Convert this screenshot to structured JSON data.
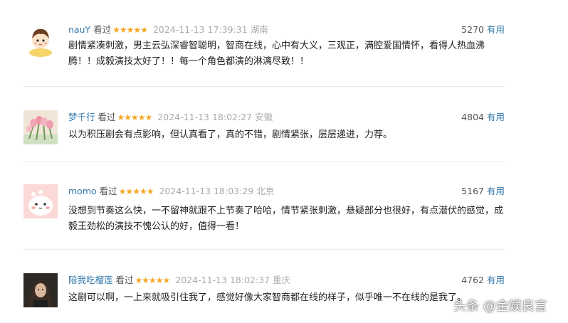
{
  "reviews": [
    {
      "user": "nauY",
      "watched": "看过",
      "stars": "★★★★★",
      "time": "2024-11-13 17:39:31",
      "location": "湖南",
      "votes": "5270",
      "vote_label": "有用",
      "text": "剧情紧凑刺激，男主云弘深睿智聪明，智商在线，心中有大义，三观正，满腔爱国情怀，看得人热血沸腾！！成毅演技太好了！！每一个角色都演的淋漓尽致！！"
    },
    {
      "user": "梦千行",
      "watched": "看过",
      "stars": "★★★★★",
      "time": "2024-11-13 18:02:27",
      "location": "安徽",
      "votes": "4804",
      "vote_label": "有用",
      "text": "以为积压剧会有点影响，但认真看了，真的不错，剧情紧张，层层递进，力荐。"
    },
    {
      "user": "momo",
      "watched": "看过",
      "stars": "★★★★★",
      "time": "2024-11-13 18:03:29",
      "location": "北京",
      "votes": "5167",
      "vote_label": "有用",
      "text": "没想到节奏这么快，一不留神就跟不上节奏了哈哈，情节紧张刺激，悬疑部分也很好，有点潜伏的感觉，成毅王劲松的演技不愧公认的好，值得一看！"
    },
    {
      "user": "陪我吃榴莲",
      "watched": "看过",
      "stars": "★★★★★",
      "time": "2024-11-13 18:02:37",
      "location": "重庆",
      "votes": "4762",
      "vote_label": "有用",
      "text": "这剧可以啊，一上来就吸引住我了，感觉好像大家智商都在线的样子，似乎唯一不在线的是我了。"
    }
  ],
  "watermark": "头条 @金娱良言",
  "colors": {
    "username": "#3377aa",
    "star": "#f5a623",
    "meta_gray": "#aaaaaa"
  },
  "star_rating": [
    5,
    5,
    5,
    5
  ]
}
